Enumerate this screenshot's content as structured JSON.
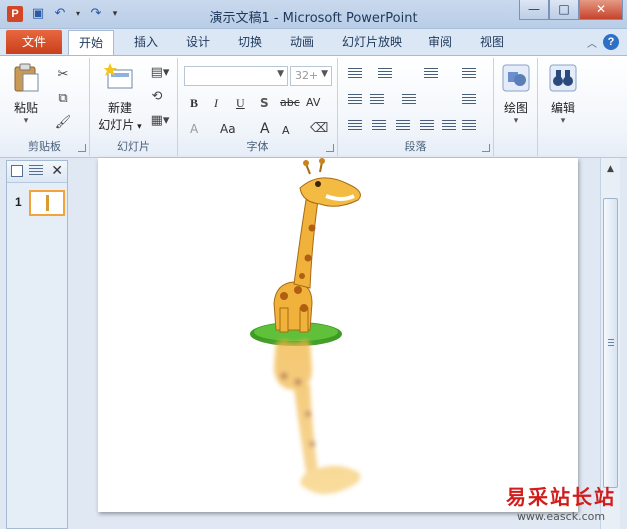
{
  "window": {
    "title": "演示文稿1 - Microsoft PowerPoint",
    "app_icon_letter": "P"
  },
  "tabs": {
    "file": "文件",
    "items": [
      {
        "label": "开始",
        "active": true
      },
      {
        "label": "插入"
      },
      {
        "label": "设计"
      },
      {
        "label": "切换"
      },
      {
        "label": "动画"
      },
      {
        "label": "幻灯片放映"
      },
      {
        "label": "审阅"
      },
      {
        "label": "视图"
      }
    ]
  },
  "ribbon": {
    "clipboard": {
      "paste": "粘贴",
      "label": "剪贴板"
    },
    "slides": {
      "new_slide_line1": "新建",
      "new_slide_line2": "幻灯片",
      "label": "幻灯片"
    },
    "font": {
      "font_name": "",
      "font_size": "32+",
      "label": "字体",
      "bold": "B",
      "italic": "I",
      "underline": "U",
      "shadow": "S",
      "strike": "abc",
      "spacing": "AV",
      "case": "Aa",
      "grow": "A",
      "shrink": "A",
      "color": "A"
    },
    "paragraph": {
      "label": "段落"
    },
    "drawing": {
      "label": "绘图"
    },
    "editing": {
      "label": "编辑"
    }
  },
  "slide_panel": {
    "slide_number": "1"
  },
  "watermark": {
    "cn": "易采站长站",
    "en": "www.easck.com"
  }
}
